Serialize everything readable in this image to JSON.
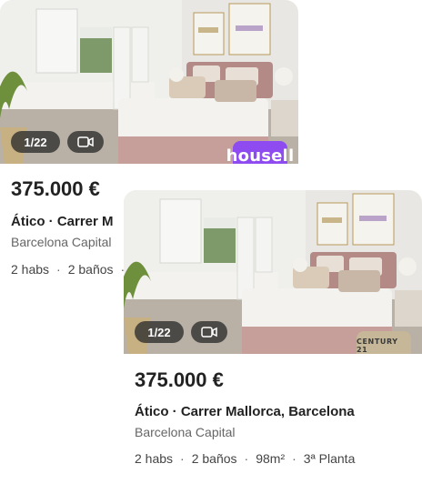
{
  "listings": [
    {
      "photo_counter": "1/22",
      "agency": "housell",
      "agency_color": "#8e4cf0",
      "price": "375.000 €",
      "title": "Ático · Carrer M",
      "location": "Barcelona Capital",
      "specs": [
        "2 habs",
        "2 baños"
      ]
    },
    {
      "photo_counter": "1/22",
      "agency": "CENTURY 21",
      "agency_color": "#c5b797",
      "price": "375.000 €",
      "title": "Ático · Carrer Mallorca, Barcelona",
      "location": "Barcelona Capital",
      "specs": [
        "2 habs",
        "2 baños",
        "98m²",
        "3ª Planta"
      ]
    }
  ],
  "icons": {
    "video": "video-camera-icon"
  }
}
